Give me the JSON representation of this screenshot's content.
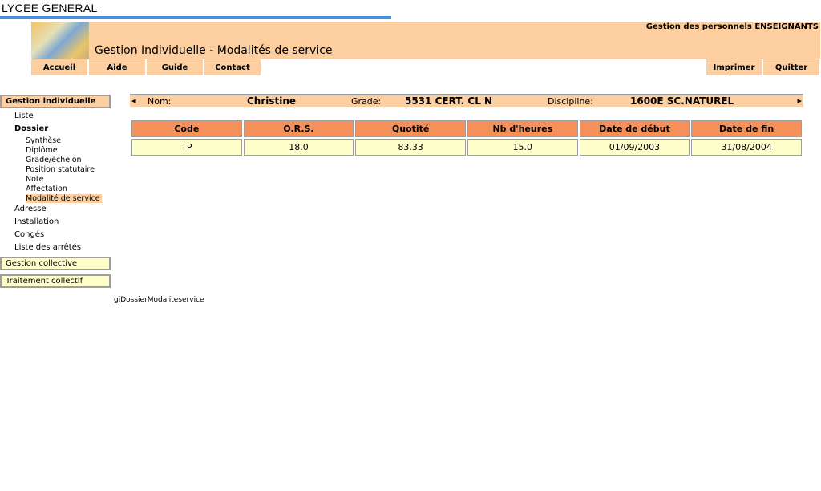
{
  "header": {
    "school": "LYCEE GENERAL",
    "title": "Gestion Individuelle - Modalités de service",
    "subtitle": "Gestion des personnels ENSEIGNANTS"
  },
  "nav": {
    "accueil": "Accueil",
    "aide": "Aide",
    "guide": "Guide",
    "contact": "Contact",
    "imprimer": "Imprimer",
    "quitter": "Quitter"
  },
  "sidebar": {
    "group_individuelle": "Gestion individuelle",
    "liste": "Liste",
    "dossier": "Dossier",
    "sub": [
      "Synthèse",
      "Diplôme",
      "Grade/échelon",
      "Position statutaire",
      "Note",
      "Affectation",
      "Modalité de service"
    ],
    "adresse": "Adresse",
    "installation": "Installation",
    "conges": "Congés",
    "liste_arretes": "Liste des arrêtés",
    "group_collective": "Gestion collective",
    "group_traitement": "Traitement collectif"
  },
  "info": {
    "nom_label": "Nom:",
    "nom_value": "Christine",
    "grade_label": "Grade:",
    "grade_value": "5531 CERT. CL N",
    "discipline_label": "Discipline:",
    "discipline_value": "1600E SC.NATUREL",
    "prev": "◂",
    "next": "▸"
  },
  "table": {
    "headers": [
      "Code",
      "O.R.S.",
      "Quotité",
      "Nb d'heures",
      "Date de début",
      "Date de fin"
    ],
    "rows": [
      [
        "TP",
        "18.0",
        "83.33",
        "15.0",
        "01/09/2003",
        "31/08/2004"
      ]
    ]
  },
  "footer": {
    "page_id": "giDossierModaliteservice"
  }
}
